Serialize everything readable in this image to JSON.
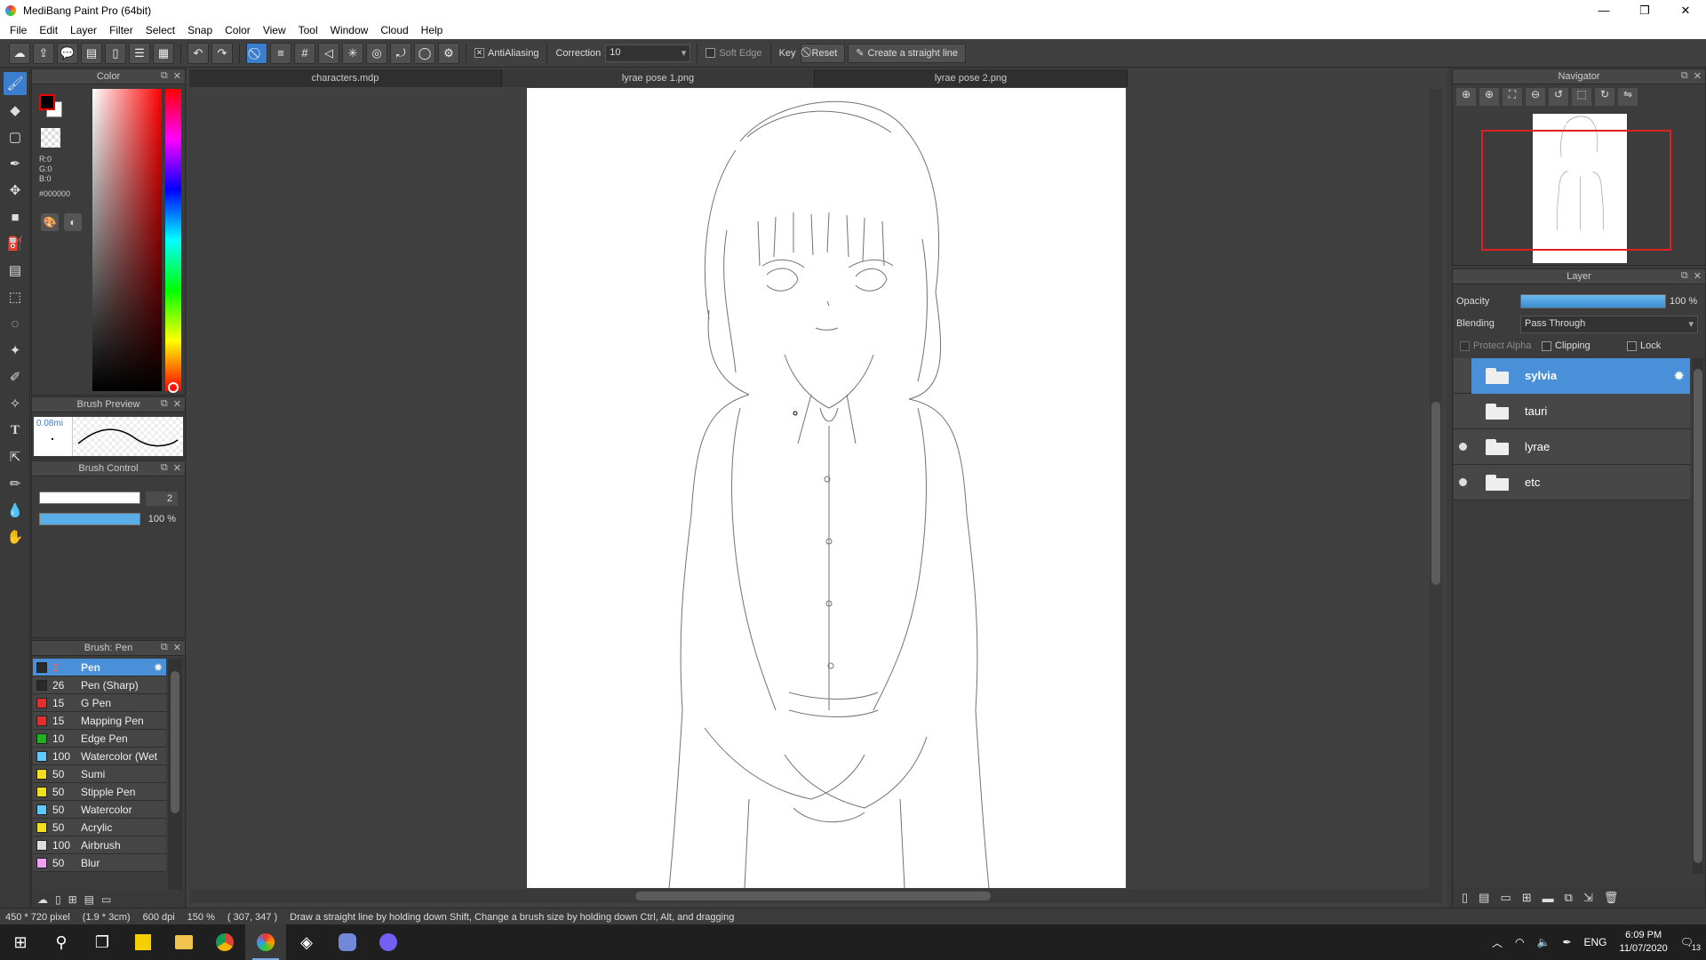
{
  "window": {
    "title": "MediBang Paint Pro (64bit)",
    "minimize": "—",
    "restore": "❐",
    "close": "✕"
  },
  "menu": [
    "File",
    "Edit",
    "Layer",
    "Filter",
    "Select",
    "Snap",
    "Color",
    "View",
    "Tool",
    "Window",
    "Cloud",
    "Help"
  ],
  "toolbar": {
    "antialiasing": "AntiAliasing",
    "correction_label": "Correction",
    "correction_value": "10",
    "soft_edge": "Soft Edge",
    "key_label": "Key",
    "reset": "Reset",
    "straight_line": "Create a straight line"
  },
  "tabs": [
    {
      "label": "characters.mdp"
    },
    {
      "label": "lyrae pose 1.png"
    },
    {
      "label": "lyrae pose 2.png"
    }
  ],
  "color_panel": {
    "title": "Color",
    "r": "R:0",
    "g": "G:0",
    "b": "B:0",
    "hex": "#000000",
    "fg_color": "#000000"
  },
  "brush_preview": {
    "title": "Brush Preview",
    "size": "0.08mi"
  },
  "brush_control": {
    "title": "Brush Control",
    "size_value": "2",
    "opacity_value": "100 %",
    "opacity_fraction": 1.0
  },
  "brush_list": {
    "title": "Brush: Pen",
    "items": [
      {
        "size": "2",
        "name": "Pen",
        "color": "#2a2a2a",
        "selected": true
      },
      {
        "size": "26",
        "name": "Pen (Sharp)",
        "color": "#2a2a2a"
      },
      {
        "size": "15",
        "name": "G Pen",
        "color": "#e03030"
      },
      {
        "size": "15",
        "name": "Mapping Pen",
        "color": "#e03030"
      },
      {
        "size": "10",
        "name": "Edge Pen",
        "color": "#20b020"
      },
      {
        "size": "100",
        "name": "Watercolor (Wet",
        "color": "#60c8ff"
      },
      {
        "size": "50",
        "name": "Sumi",
        "color": "#f0e020"
      },
      {
        "size": "50",
        "name": "Stipple Pen",
        "color": "#f0e020"
      },
      {
        "size": "50",
        "name": "Watercolor",
        "color": "#60c8ff"
      },
      {
        "size": "50",
        "name": "Acrylic",
        "color": "#f0e020"
      },
      {
        "size": "100",
        "name": "Airbrush",
        "color": "#dddddd"
      },
      {
        "size": "50",
        "name": "Blur",
        "color": "#f0a0f0"
      }
    ]
  },
  "navigator": {
    "title": "Navigator"
  },
  "layer_panel": {
    "title": "Layer",
    "opacity_label": "Opacity",
    "opacity_value": "100 %",
    "opacity_fraction": 1.0,
    "blending_label": "Blending",
    "blending_value": "Pass Through",
    "protect_alpha": "Protect Alpha",
    "clipping": "Clipping",
    "lock": "Lock",
    "layers": [
      {
        "name": "sylvia",
        "selected": true,
        "visible": false
      },
      {
        "name": "tauri",
        "selected": false,
        "visible": false
      },
      {
        "name": "lyrae",
        "selected": false,
        "visible": true
      },
      {
        "name": "etc",
        "selected": false,
        "visible": true
      }
    ]
  },
  "status": {
    "size": "450 * 720 pixel",
    "cm": "(1.9 * 3cm)",
    "dpi": "600 dpi",
    "zoom": "150 %",
    "coords": "( 307, 347 )",
    "hint": "Draw a straight line by holding down Shift, Change a brush size by holding down Ctrl, Alt, and dragging"
  },
  "taskbar": {
    "lang": "ENG",
    "time": "6:09 PM",
    "date": "11/07/2020",
    "notifications": "13"
  }
}
